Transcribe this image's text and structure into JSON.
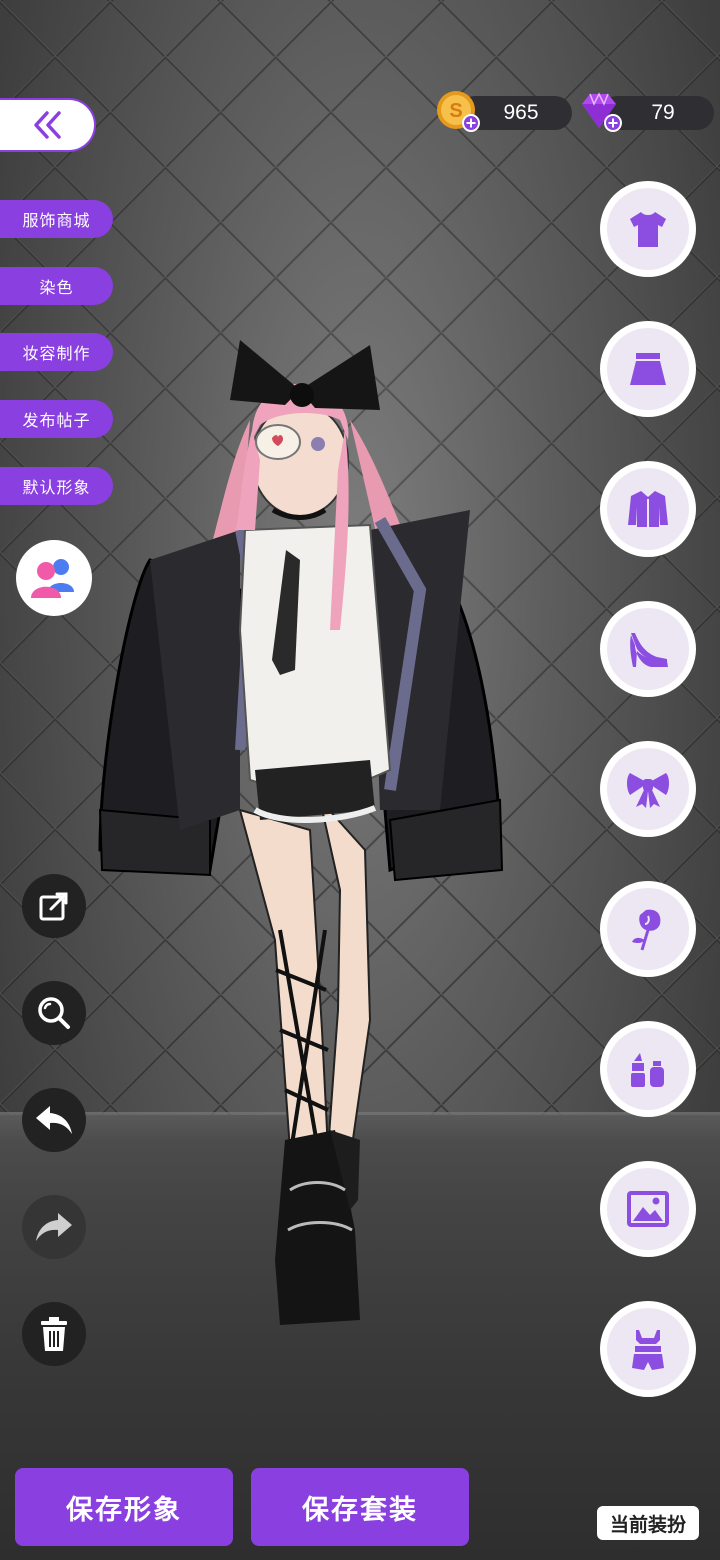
{
  "currency": {
    "coins": "965",
    "gems": "79"
  },
  "side_menu": {
    "items": [
      "服饰商城",
      "染色",
      "妆容制作",
      "发布帖子",
      "默认形象"
    ]
  },
  "tools": [
    "share-icon",
    "zoom-icon",
    "undo-icon",
    "redo-icon",
    "delete-icon"
  ],
  "categories": [
    "top-icon",
    "skirt-icon",
    "jacket-icon",
    "heels-icon",
    "bow-icon",
    "rose-icon",
    "lipstick-icon",
    "background-icon",
    "set-icon"
  ],
  "bottom": {
    "save_look": "保存形象",
    "save_outfit": "保存套装",
    "current_outfit": "当前装扮"
  },
  "colors": {
    "accent": "#8a3fe0",
    "icon_purple": "#8c4ee0"
  }
}
